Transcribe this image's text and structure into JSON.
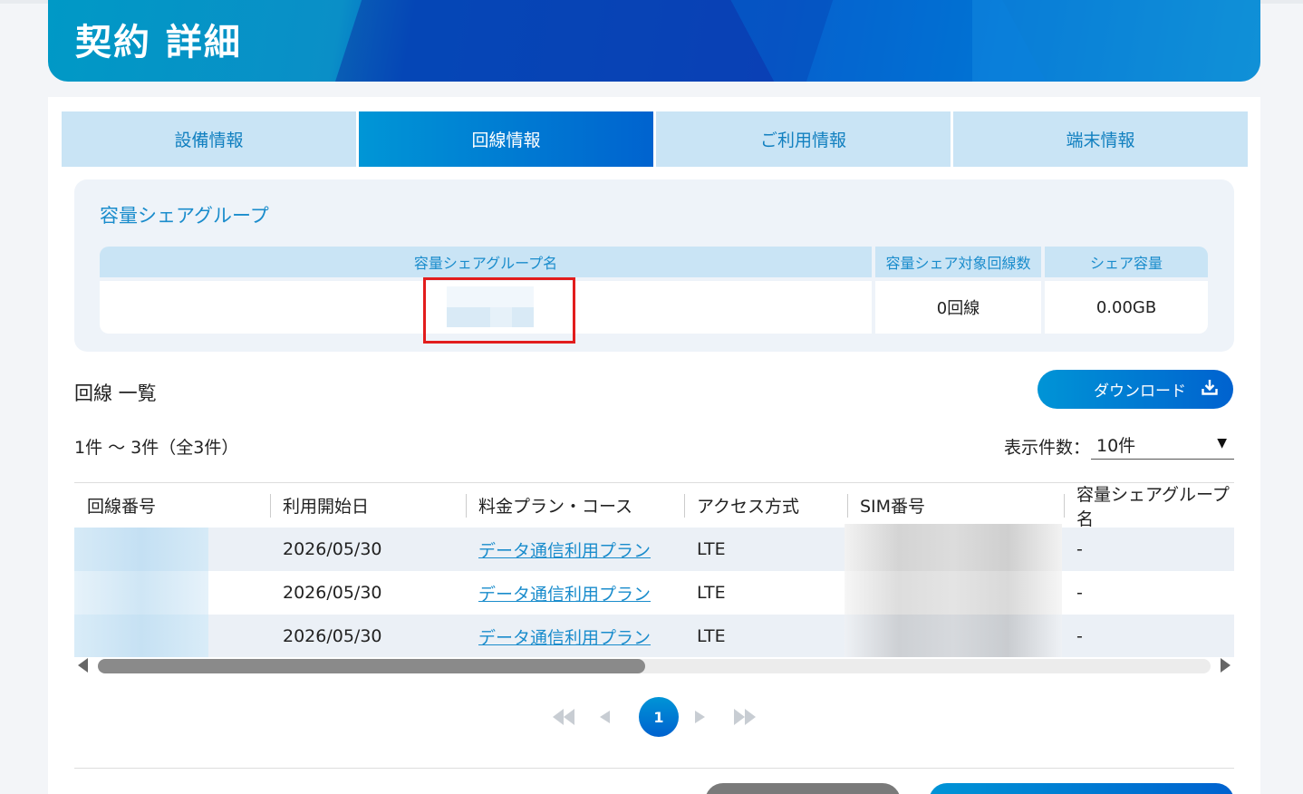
{
  "page": {
    "title": "契約 詳細"
  },
  "tabs": [
    {
      "label": "設備情報",
      "active": false
    },
    {
      "label": "回線情報",
      "active": true
    },
    {
      "label": "ご利用情報",
      "active": false
    },
    {
      "label": "端末情報",
      "active": false
    }
  ],
  "share_group": {
    "title": "容量シェアグループ",
    "headers": [
      "容量シェアグループ名",
      "容量シェア対象回線数",
      "シェア容量"
    ],
    "row": {
      "name": "",
      "lines": "0回線",
      "capacity": "0.00GB"
    }
  },
  "line_list": {
    "title": "回線 一覧",
    "download_label": "ダウンロード",
    "count_text": "1件 〜 3件（全3件）",
    "per_page_label": "表示件数：",
    "per_page_value": "10件",
    "columns": [
      "回線番号",
      "利用開始日",
      "料金プラン・コース",
      "アクセス方式",
      "SIM番号",
      "容量シェアグループ名"
    ],
    "rows": [
      {
        "line_no": "",
        "start_date": "2026/05/30",
        "plan": "データ通信利用プラン",
        "access": "LTE",
        "sim": "",
        "group": "-"
      },
      {
        "line_no": "",
        "start_date": "2026/05/30",
        "plan": "データ通信利用プラン",
        "access": "LTE",
        "sim": "",
        "group": "-"
      },
      {
        "line_no": "",
        "start_date": "2026/05/30",
        "plan": "データ通信利用プラン",
        "access": "LTE",
        "sim": "",
        "group": "-"
      }
    ],
    "scroll_fraction": 0.49
  },
  "pagination": {
    "first": "⏪",
    "prev": "◀",
    "current": "1",
    "next": "▶",
    "last": "⏩"
  },
  "colors": {
    "accent": "#0a7fd0",
    "tab_bg": "#c9e4f5",
    "highlight": "#e21d1d"
  }
}
